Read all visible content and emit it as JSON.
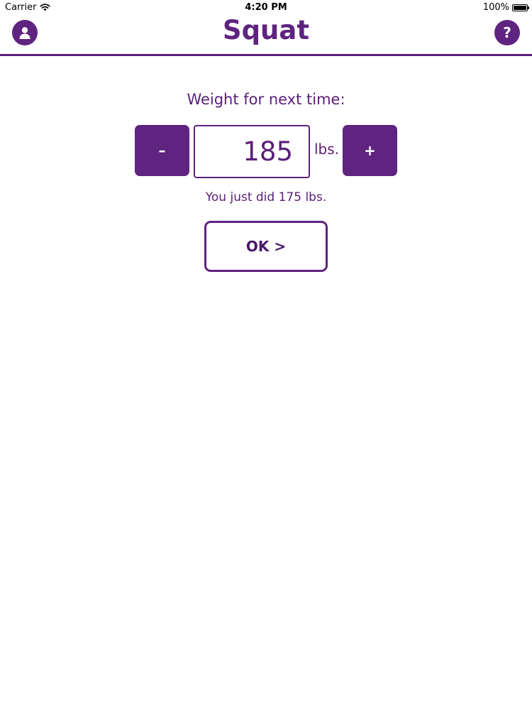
{
  "status_bar": {
    "carrier": "Carrier",
    "time": "4:20 PM",
    "battery": "100%"
  },
  "nav": {
    "title": "Squat",
    "profile_icon": "person-icon",
    "help_icon": "question-icon",
    "help_glyph": "?"
  },
  "content": {
    "prompt": "Weight for next time:",
    "minus_label": "–",
    "plus_label": "+",
    "weight_value": "185",
    "unit": "lbs.",
    "previous_note": "You just did 175 lbs.",
    "ok_label": "OK >"
  },
  "colors": {
    "accent": "#5f2380",
    "text": "#5a1f78",
    "background": "#ffffff"
  }
}
